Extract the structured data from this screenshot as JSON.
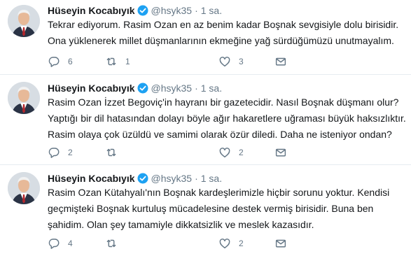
{
  "tweets": [
    {
      "name": "Hüseyin Kocabıyık",
      "handle": "@hsyk35",
      "separator": "·",
      "time": "1 sa.",
      "lines": [
        "Tekrar ediyorum. Rasim Ozan en az benim kadar Boşnak sevgisiyle dolu birisidir.",
        "Ona yüklenerek millet düşmanlarının ekmeğine yağ sürdüğümüzü unutmayalım."
      ],
      "replies": "6",
      "retweets": "1",
      "likes": "3"
    },
    {
      "name": "Hüseyin Kocabıyık",
      "handle": "@hsyk35",
      "separator": "·",
      "time": "1 sa.",
      "lines": [
        "Rasim Ozan İzzet Begoviç'in hayranı bir gazetecidir. Nasıl Boşnak düşmanı olur?",
        "Yaptığı bir dil hatasından dolayı böyle ağır hakaretlere uğraması büyük haksızlıktır.",
        "Rasim olaya çok üzüldü ve samimi olarak özür diledi. Daha ne isteniyor ondan?"
      ],
      "replies": "2",
      "retweets": "",
      "likes": "2"
    },
    {
      "name": "Hüseyin Kocabıyık",
      "handle": "@hsyk35",
      "separator": "·",
      "time": "1 sa.",
      "lines": [
        "Rasim Ozan Kütahyalı'nın Boşnak kardeşlerimizle hiçbir sorunu yoktur. Kendisi",
        "geçmişteki Boşnak kurtuluş mücadelesine destek vermiş birisidir. Buna ben",
        "şahidim. Olan şey tamamiyle dikkatsizlik ve meslek kazasıdır."
      ],
      "replies": "4",
      "retweets": "",
      "likes": "2"
    }
  ],
  "icons": {
    "reply": "reply-icon",
    "retweet": "retweet-icon",
    "like": "heart-icon",
    "message": "envelope-icon",
    "verified": "verified-badge-icon"
  },
  "colors": {
    "text": "#14171a",
    "muted": "#657786",
    "verified": "#1da1f2",
    "divider": "#e6ecf0"
  }
}
